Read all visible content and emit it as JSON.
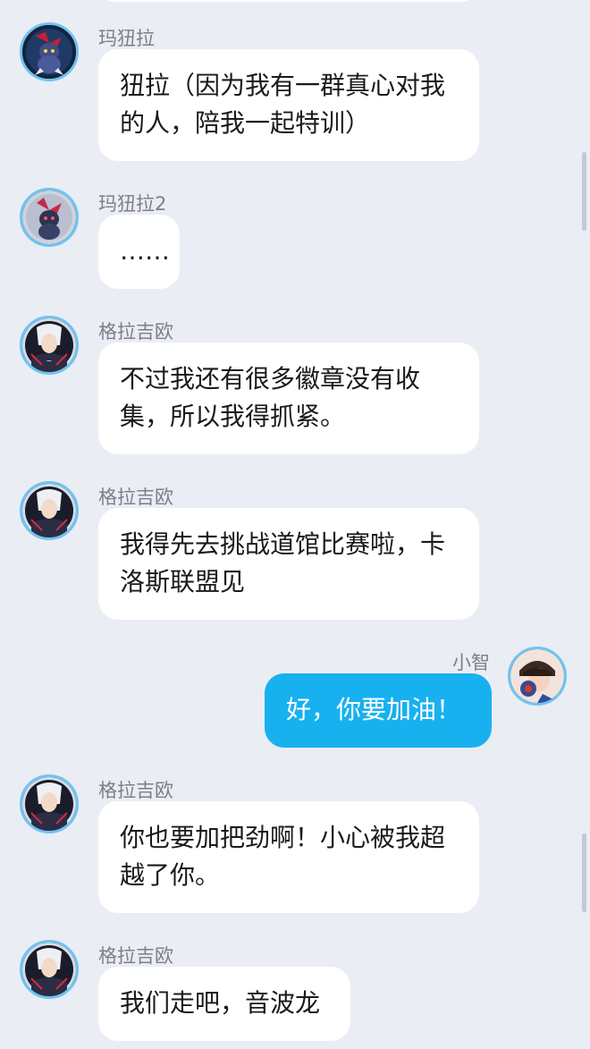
{
  "messages": [
    {
      "sender": "玛狃拉",
      "side": "left",
      "avatar": "weavile-avatar",
      "text": "狃拉（因为我有一群真心对我的人，陪我一起特训）"
    },
    {
      "sender": "玛狃拉2",
      "side": "left",
      "avatar": "weavile-avatar",
      "text": "……"
    },
    {
      "sender": "格拉吉欧",
      "side": "left",
      "avatar": "gladion-avatar",
      "text": "不过我还有很多徽章没有收集，所以我得抓紧。"
    },
    {
      "sender": "格拉吉欧",
      "side": "left",
      "avatar": "gladion-avatar",
      "text": "我得先去挑战道馆比赛啦，卡洛斯联盟见"
    },
    {
      "sender": "小智",
      "side": "right",
      "avatar": "ash-avatar",
      "text": "好，你要加油！"
    },
    {
      "sender": "格拉吉欧",
      "side": "left",
      "avatar": "gladion-avatar",
      "text": "你也要加把劲啊！小心被我超越了你。"
    },
    {
      "sender": "格拉吉欧",
      "side": "left",
      "avatar": "gladion-avatar",
      "text": "我们走吧，音波龙"
    }
  ],
  "colors": {
    "background": "#eaedf4",
    "incoming_bubble": "#ffffff",
    "outgoing_bubble": "#18b1f0",
    "avatar_ring": "#6fc4f2",
    "sender_text": "#7b8089"
  }
}
